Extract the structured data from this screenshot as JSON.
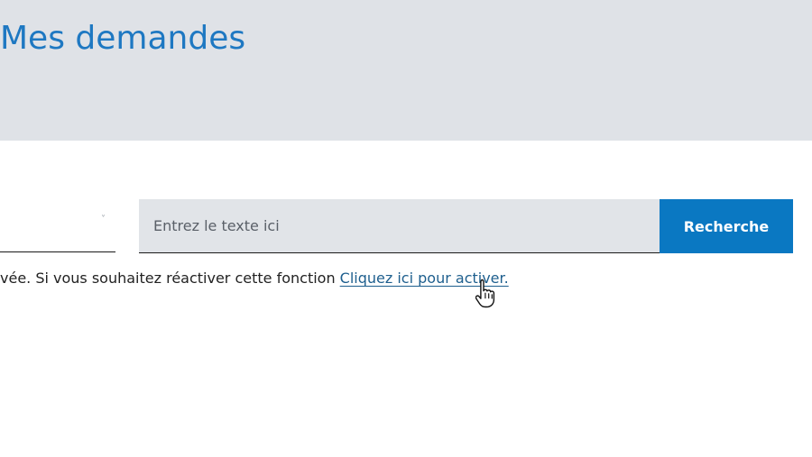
{
  "header": {
    "title": "Mes demandes"
  },
  "search": {
    "placeholder": "Entrez le texte ici",
    "button_label": "Recherche",
    "select_arrow": "˅"
  },
  "notice": {
    "text": "vée. Si vous souhaitez réactiver cette fonction ",
    "link_label": "Cliquez ici pour activer."
  },
  "colors": {
    "header_background": "#dfe2e7",
    "title": "#1e78c2",
    "button_background": "#0a78c2",
    "input_background": "#e1e4e8",
    "link": "#1e5f8e"
  },
  "icons": {
    "cursor": "hand-pointer-cursor-icon",
    "select": "chevron-down-icon"
  }
}
